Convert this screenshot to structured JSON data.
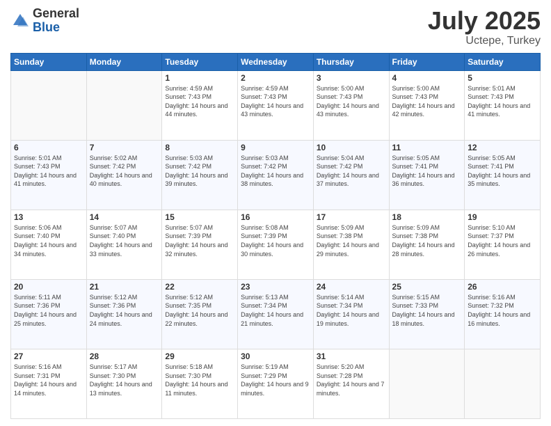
{
  "logo": {
    "general": "General",
    "blue": "Blue"
  },
  "title": {
    "month_year": "July 2025",
    "location": "Uctepe, Turkey"
  },
  "days_of_week": [
    "Sunday",
    "Monday",
    "Tuesday",
    "Wednesday",
    "Thursday",
    "Friday",
    "Saturday"
  ],
  "weeks": [
    [
      {
        "day": "",
        "empty": true
      },
      {
        "day": "",
        "empty": true
      },
      {
        "day": "1",
        "sunrise": "Sunrise: 4:59 AM",
        "sunset": "Sunset: 7:43 PM",
        "daylight": "Daylight: 14 hours and 44 minutes."
      },
      {
        "day": "2",
        "sunrise": "Sunrise: 4:59 AM",
        "sunset": "Sunset: 7:43 PM",
        "daylight": "Daylight: 14 hours and 43 minutes."
      },
      {
        "day": "3",
        "sunrise": "Sunrise: 5:00 AM",
        "sunset": "Sunset: 7:43 PM",
        "daylight": "Daylight: 14 hours and 43 minutes."
      },
      {
        "day": "4",
        "sunrise": "Sunrise: 5:00 AM",
        "sunset": "Sunset: 7:43 PM",
        "daylight": "Daylight: 14 hours and 42 minutes."
      },
      {
        "day": "5",
        "sunrise": "Sunrise: 5:01 AM",
        "sunset": "Sunset: 7:43 PM",
        "daylight": "Daylight: 14 hours and 41 minutes."
      }
    ],
    [
      {
        "day": "6",
        "sunrise": "Sunrise: 5:01 AM",
        "sunset": "Sunset: 7:43 PM",
        "daylight": "Daylight: 14 hours and 41 minutes."
      },
      {
        "day": "7",
        "sunrise": "Sunrise: 5:02 AM",
        "sunset": "Sunset: 7:42 PM",
        "daylight": "Daylight: 14 hours and 40 minutes."
      },
      {
        "day": "8",
        "sunrise": "Sunrise: 5:03 AM",
        "sunset": "Sunset: 7:42 PM",
        "daylight": "Daylight: 14 hours and 39 minutes."
      },
      {
        "day": "9",
        "sunrise": "Sunrise: 5:03 AM",
        "sunset": "Sunset: 7:42 PM",
        "daylight": "Daylight: 14 hours and 38 minutes."
      },
      {
        "day": "10",
        "sunrise": "Sunrise: 5:04 AM",
        "sunset": "Sunset: 7:42 PM",
        "daylight": "Daylight: 14 hours and 37 minutes."
      },
      {
        "day": "11",
        "sunrise": "Sunrise: 5:05 AM",
        "sunset": "Sunset: 7:41 PM",
        "daylight": "Daylight: 14 hours and 36 minutes."
      },
      {
        "day": "12",
        "sunrise": "Sunrise: 5:05 AM",
        "sunset": "Sunset: 7:41 PM",
        "daylight": "Daylight: 14 hours and 35 minutes."
      }
    ],
    [
      {
        "day": "13",
        "sunrise": "Sunrise: 5:06 AM",
        "sunset": "Sunset: 7:40 PM",
        "daylight": "Daylight: 14 hours and 34 minutes."
      },
      {
        "day": "14",
        "sunrise": "Sunrise: 5:07 AM",
        "sunset": "Sunset: 7:40 PM",
        "daylight": "Daylight: 14 hours and 33 minutes."
      },
      {
        "day": "15",
        "sunrise": "Sunrise: 5:07 AM",
        "sunset": "Sunset: 7:39 PM",
        "daylight": "Daylight: 14 hours and 32 minutes."
      },
      {
        "day": "16",
        "sunrise": "Sunrise: 5:08 AM",
        "sunset": "Sunset: 7:39 PM",
        "daylight": "Daylight: 14 hours and 30 minutes."
      },
      {
        "day": "17",
        "sunrise": "Sunrise: 5:09 AM",
        "sunset": "Sunset: 7:38 PM",
        "daylight": "Daylight: 14 hours and 29 minutes."
      },
      {
        "day": "18",
        "sunrise": "Sunrise: 5:09 AM",
        "sunset": "Sunset: 7:38 PM",
        "daylight": "Daylight: 14 hours and 28 minutes."
      },
      {
        "day": "19",
        "sunrise": "Sunrise: 5:10 AM",
        "sunset": "Sunset: 7:37 PM",
        "daylight": "Daylight: 14 hours and 26 minutes."
      }
    ],
    [
      {
        "day": "20",
        "sunrise": "Sunrise: 5:11 AM",
        "sunset": "Sunset: 7:36 PM",
        "daylight": "Daylight: 14 hours and 25 minutes."
      },
      {
        "day": "21",
        "sunrise": "Sunrise: 5:12 AM",
        "sunset": "Sunset: 7:36 PM",
        "daylight": "Daylight: 14 hours and 24 minutes."
      },
      {
        "day": "22",
        "sunrise": "Sunrise: 5:12 AM",
        "sunset": "Sunset: 7:35 PM",
        "daylight": "Daylight: 14 hours and 22 minutes."
      },
      {
        "day": "23",
        "sunrise": "Sunrise: 5:13 AM",
        "sunset": "Sunset: 7:34 PM",
        "daylight": "Daylight: 14 hours and 21 minutes."
      },
      {
        "day": "24",
        "sunrise": "Sunrise: 5:14 AM",
        "sunset": "Sunset: 7:34 PM",
        "daylight": "Daylight: 14 hours and 19 minutes."
      },
      {
        "day": "25",
        "sunrise": "Sunrise: 5:15 AM",
        "sunset": "Sunset: 7:33 PM",
        "daylight": "Daylight: 14 hours and 18 minutes."
      },
      {
        "day": "26",
        "sunrise": "Sunrise: 5:16 AM",
        "sunset": "Sunset: 7:32 PM",
        "daylight": "Daylight: 14 hours and 16 minutes."
      }
    ],
    [
      {
        "day": "27",
        "sunrise": "Sunrise: 5:16 AM",
        "sunset": "Sunset: 7:31 PM",
        "daylight": "Daylight: 14 hours and 14 minutes."
      },
      {
        "day": "28",
        "sunrise": "Sunrise: 5:17 AM",
        "sunset": "Sunset: 7:30 PM",
        "daylight": "Daylight: 14 hours and 13 minutes."
      },
      {
        "day": "29",
        "sunrise": "Sunrise: 5:18 AM",
        "sunset": "Sunset: 7:30 PM",
        "daylight": "Daylight: 14 hours and 11 minutes."
      },
      {
        "day": "30",
        "sunrise": "Sunrise: 5:19 AM",
        "sunset": "Sunset: 7:29 PM",
        "daylight": "Daylight: 14 hours and 9 minutes."
      },
      {
        "day": "31",
        "sunrise": "Sunrise: 5:20 AM",
        "sunset": "Sunset: 7:28 PM",
        "daylight": "Daylight: 14 hours and 7 minutes."
      },
      {
        "day": "",
        "empty": true
      },
      {
        "day": "",
        "empty": true
      }
    ]
  ]
}
